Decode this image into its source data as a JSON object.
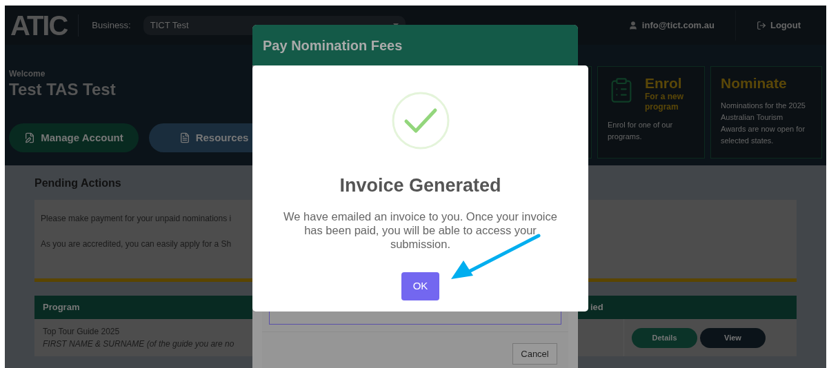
{
  "header": {
    "logo": "ATIC",
    "business_label": "Business:",
    "business_select": {
      "value": "TICT Test"
    },
    "user_email": "info@tict.com.au",
    "logout": "Logout"
  },
  "welcome": {
    "greeting": "Welcome",
    "name": "Test TAS Test"
  },
  "actions": [
    {
      "kind": "account",
      "label": "Manage Account"
    },
    {
      "kind": "resources",
      "label": "Resources"
    }
  ],
  "cards": [
    {
      "kind": "enrol",
      "title": "Enrol",
      "subtitle": "For a new program",
      "text": "Enrol for one of our programs."
    },
    {
      "kind": "nominate",
      "title": "Nominate",
      "text": "Nominations for the 2025 Australian Tourism Awards are now open for selected states."
    }
  ],
  "pending": {
    "title": "Pending Actions",
    "messages": [
      "Please make payment for your unpaid nominations i",
      "As you are accredited, you can easily apply for a Sh"
    ],
    "table": {
      "columns": [
        "Program",
        "ied"
      ],
      "rows": [
        {
          "program": "Top Tour Guide 2025",
          "detail": "FIRST NAME & SURNAME (of the guide you are no",
          "buttons": [
            "Details",
            "View"
          ]
        }
      ]
    }
  },
  "pay_modal": {
    "title": "Pay Nomination Fees",
    "cancel": "Cancel"
  },
  "dialog": {
    "title": "Invoice Generated",
    "message": "We have emailed an invoice to you. Once your invoice has been paid, you will be able to access your submission.",
    "ok": "OK"
  }
}
